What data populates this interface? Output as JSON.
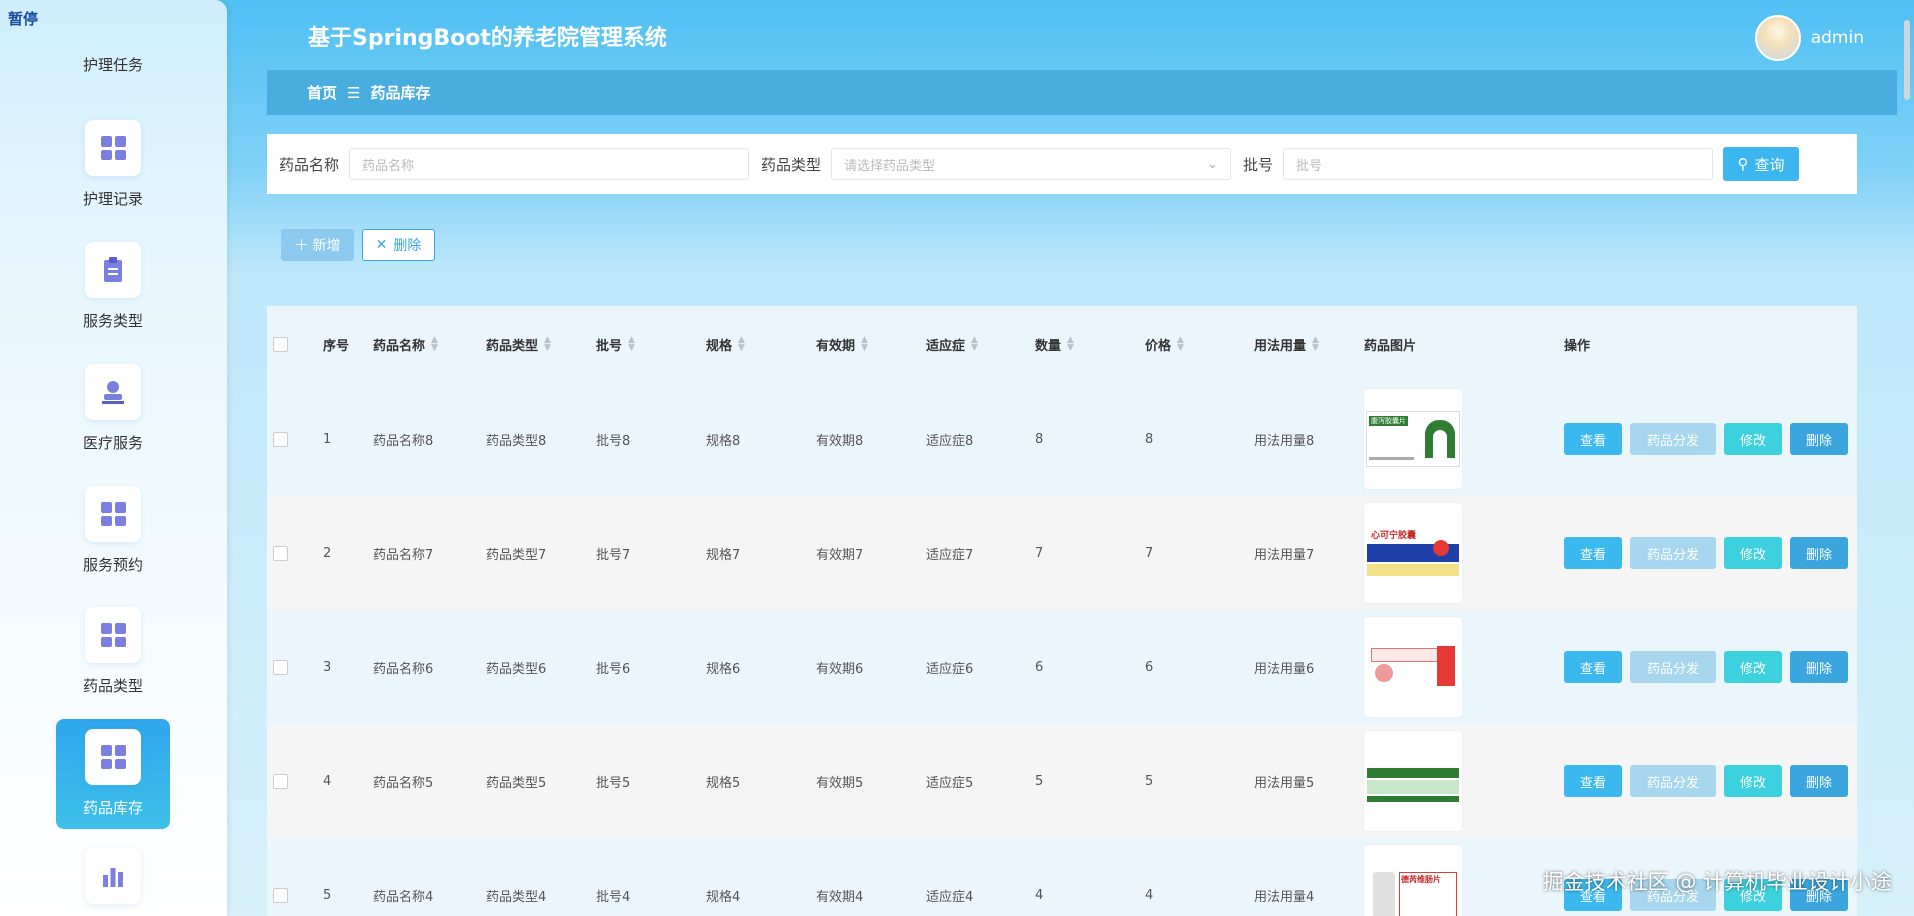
{
  "sidebar": {
    "top_label": "暂停",
    "items": [
      {
        "label": "护理任务",
        "icon": "grid-icon"
      },
      {
        "label": "护理记录",
        "icon": "grid-icon"
      },
      {
        "label": "服务类型",
        "icon": "clipboard-icon"
      },
      {
        "label": "医疗服务",
        "icon": "stamp-icon"
      },
      {
        "label": "服务预约",
        "icon": "grid-icon"
      },
      {
        "label": "药品类型",
        "icon": "grid-icon"
      },
      {
        "label": "药品库存",
        "icon": "grid-icon",
        "active": true
      },
      {
        "label": "",
        "icon": "bar-chart-icon"
      }
    ]
  },
  "header": {
    "title": "基于SpringBoot的养老院管理系统",
    "user": "admin"
  },
  "breadcrumb": {
    "home": "首页",
    "current": "药品库存"
  },
  "search": {
    "name_label": "药品名称",
    "name_placeholder": "药品名称",
    "type_label": "药品类型",
    "type_placeholder": "请选择药品类型",
    "batch_label": "批号",
    "batch_placeholder": "批号",
    "query_label": "查询"
  },
  "toolbar": {
    "add_label": "新增",
    "delete_label": "删除"
  },
  "table": {
    "columns": [
      "序号",
      "药品名称",
      "药品类型",
      "批号",
      "规格",
      "有效期",
      "适应症",
      "数量",
      "价格",
      "用法用量",
      "药品图片",
      "操作"
    ],
    "actions": {
      "view": "查看",
      "distribute": "药品分发",
      "edit": "修改",
      "delete": "删除"
    },
    "rows": [
      {
        "no": "1",
        "name": "药品名称8",
        "type": "药品类型8",
        "batch": "批号8",
        "spec": "规格8",
        "expiry": "有效期8",
        "indication": "适应症8",
        "qty": "8",
        "price": "8",
        "usage": "用法用量8",
        "img_text": "腹泻胶囊片"
      },
      {
        "no": "2",
        "name": "药品名称7",
        "type": "药品类型7",
        "batch": "批号7",
        "spec": "规格7",
        "expiry": "有效期7",
        "indication": "适应症7",
        "qty": "7",
        "price": "7",
        "usage": "用法用量7",
        "img_text": "心可宁胶囊"
      },
      {
        "no": "3",
        "name": "药品名称6",
        "type": "药品类型6",
        "batch": "批号6",
        "spec": "规格6",
        "expiry": "有效期6",
        "indication": "适应症6",
        "qty": "6",
        "price": "6",
        "usage": "用法用量6",
        "img_text": ""
      },
      {
        "no": "4",
        "name": "药品名称5",
        "type": "药品类型5",
        "batch": "批号5",
        "spec": "规格5",
        "expiry": "有效期5",
        "indication": "适应症5",
        "qty": "5",
        "price": "5",
        "usage": "用法用量5",
        "img_text": ""
      },
      {
        "no": "5",
        "name": "药品名称4",
        "type": "药品类型4",
        "batch": "批号4",
        "spec": "规格4",
        "expiry": "有效期4",
        "indication": "适应症4",
        "qty": "4",
        "price": "4",
        "usage": "用法用量4",
        "img_text": "德芮维肠片"
      }
    ]
  },
  "watermark": "掘金技术社区 @ 计算机毕业设计小途"
}
